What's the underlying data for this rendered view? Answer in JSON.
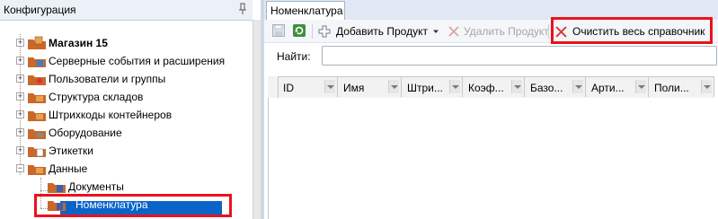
{
  "left_panel": {
    "title": "Конфигурация",
    "tree": [
      {
        "label": "Магазин 15",
        "bold": true
      },
      {
        "label": "Серверные события и расширения"
      },
      {
        "label": "Пользователи и группы"
      },
      {
        "label": "Структура складов"
      },
      {
        "label": "Штрихкоды контейнеров"
      },
      {
        "label": "Оборудование"
      },
      {
        "label": "Этикетки"
      },
      {
        "label": "Данные"
      },
      {
        "label": "Документы"
      },
      {
        "label": "Номенклатура",
        "selected": true
      }
    ]
  },
  "right_panel": {
    "tab_label": "Номенклатура",
    "toolbar": {
      "add_label": "Добавить Продукт",
      "delete_label": "Удалить Продукт",
      "clear_label": "Очистить весь справочник"
    },
    "search": {
      "label": "Найти:",
      "value": ""
    },
    "columns": [
      "ID",
      "Имя",
      "Штри...",
      "Коэф...",
      "Базо...",
      "Арти...",
      "Поли..."
    ]
  },
  "colors": {
    "highlight": "#e8141c",
    "selection": "#0a64c8",
    "folder": "#c8682a"
  }
}
